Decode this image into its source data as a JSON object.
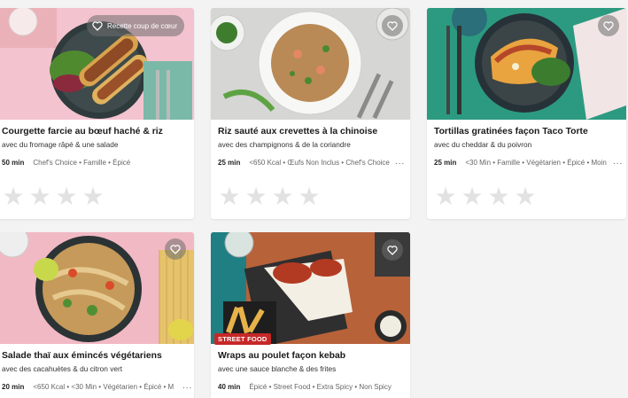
{
  "cards": [
    {
      "title": "Courgette farcie au bœuf haché & riz",
      "subtitle": "avec du fromage râpé & une salade",
      "time": "50 min",
      "tags": "Chef's Choice • Famille • Épicé",
      "favorite_label": "Recette coup de cœur",
      "favorite_icon": "heart-outline-icon"
    },
    {
      "title": "Riz sauté aux crevettes à la chinoise",
      "subtitle": "avec des champignons & de la coriandre",
      "time": "25 min",
      "tags": "<650 Kcal • Œufs Non Inclus • Chef's Choice",
      "more": "...",
      "favorite_icon": "heart-outline-icon"
    },
    {
      "title": "Tortillas gratinées façon Taco Torte",
      "subtitle": "avec du cheddar & du poivron",
      "time": "25 min",
      "tags": "<30 Min • Famille • Végétarien • Épicé • Moin",
      "more": "...",
      "favorite_icon": "heart-outline-icon"
    },
    {
      "title": "Salade thaï aux émincés végétariens",
      "subtitle": "avec des cacahuètes & du citron vert",
      "time": "20 min",
      "tags": "<650 Kcal • <30 Min • Végétarien • Épicé • M",
      "more": "...",
      "favorite_icon": "heart-outline-icon"
    },
    {
      "title": "Wraps au poulet façon kebab",
      "subtitle": "avec une sauce blanche & des frites",
      "time": "40 min",
      "tags": "Épicé • Street Food • Extra Spicy • Non Spicy",
      "badge": "STREET FOOD",
      "favorite_icon": "heart-outline-icon"
    }
  ],
  "rating": {
    "star_icon": "star-icon",
    "max": 5
  },
  "colors": {
    "badge": "#c62828",
    "star_empty": "#e2e2e2"
  }
}
